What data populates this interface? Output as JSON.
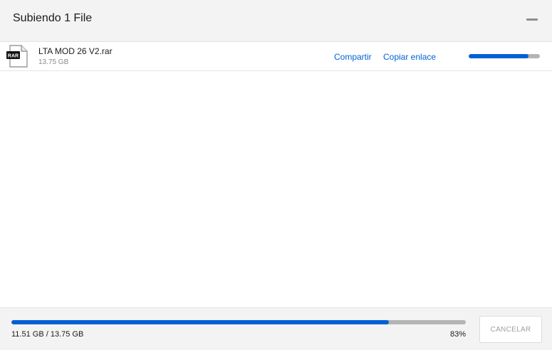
{
  "header": {
    "title": "Subiendo 1 File",
    "minimize_icon": "minimize-icon"
  },
  "files": [
    {
      "name": "LTA MOD 26 V2.rar",
      "size": "13.75 GB",
      "type_badge": "RAR",
      "share_label": "Compartir",
      "copy_link_label": "Copiar enlace",
      "progress_fraction": 0.84
    }
  ],
  "footer": {
    "transferred": "11.51 GB / 13.75 GB",
    "percent": "83%",
    "progress_fraction": 0.83,
    "cancel_label": "CANCELAR"
  },
  "colors": {
    "accent": "#0061d5",
    "track": "#b4b4b4",
    "header_bg": "#f3f3f3"
  }
}
